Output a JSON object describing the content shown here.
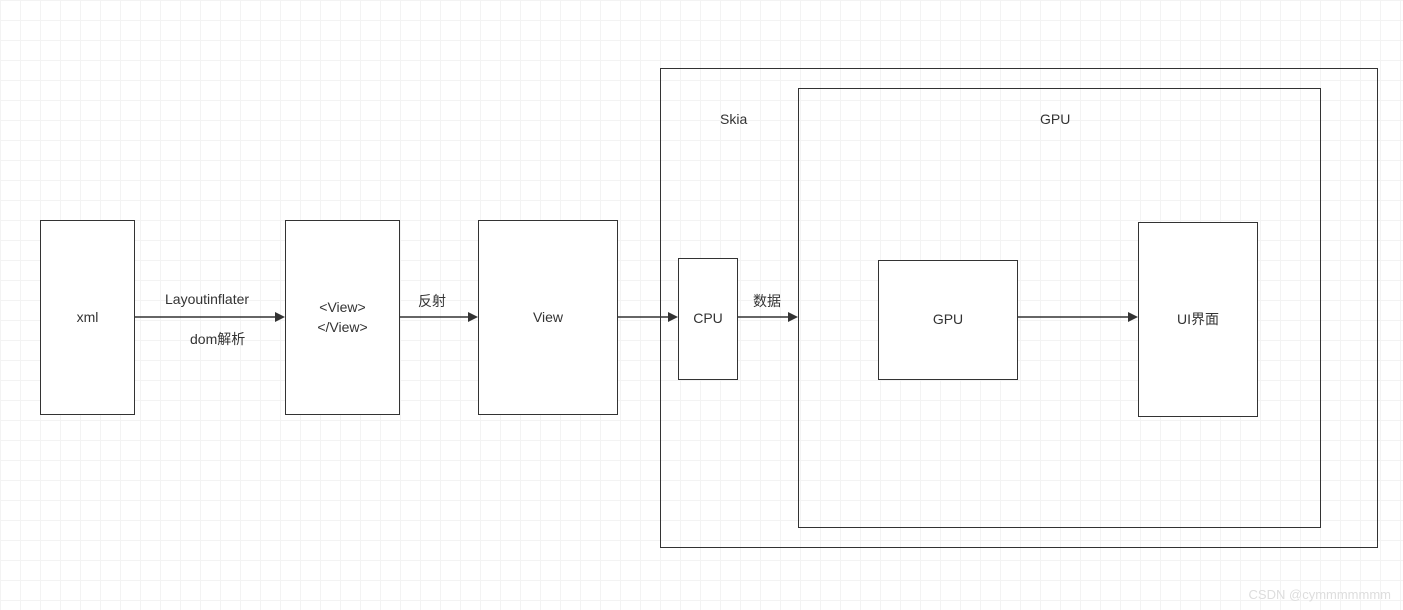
{
  "boxes": {
    "xml": "xml",
    "view_tag_line1": "<View>",
    "view_tag_line2": "</View>",
    "view": "View",
    "cpu": "CPU",
    "gpu_inner": "GPU",
    "ui": "UI界面"
  },
  "containers": {
    "skia": "Skia",
    "gpu_outer": "GPU"
  },
  "arrows": {
    "layoutinflater": "Layoutinflater",
    "dom_parse": "dom解析",
    "reflect": "反射",
    "data": "数据"
  },
  "watermark": "CSDN @cymmmmmmm"
}
